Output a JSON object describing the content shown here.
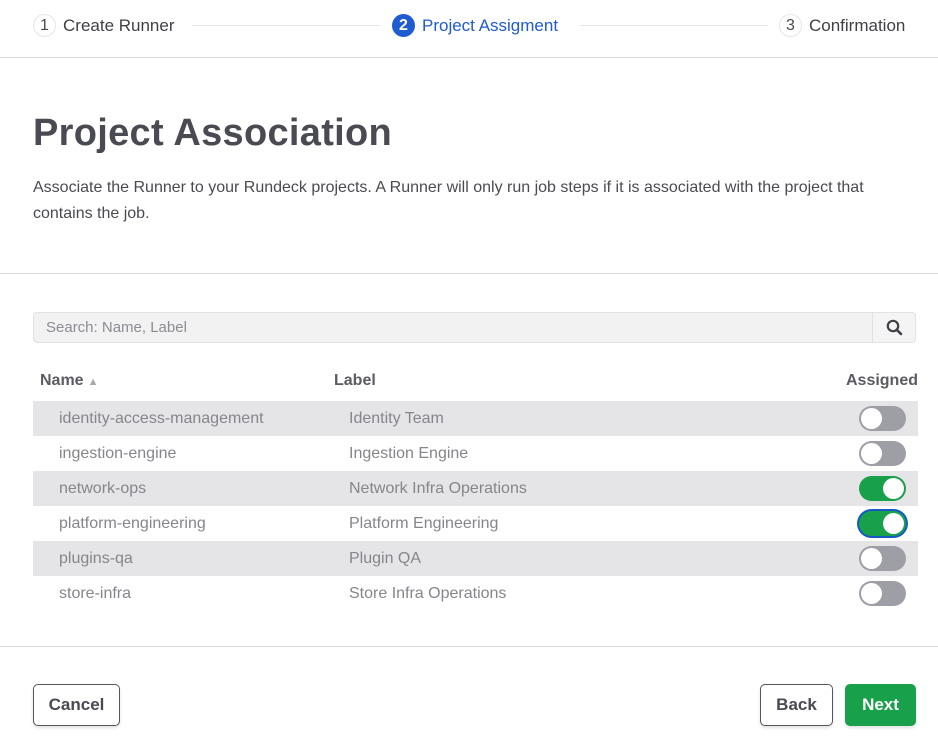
{
  "stepper": {
    "steps": [
      {
        "number": "1",
        "label": "Create Runner",
        "state": "inactive"
      },
      {
        "number": "2",
        "label": "Project Assigment",
        "state": "active"
      },
      {
        "number": "3",
        "label": "Confirmation",
        "state": "inactive"
      }
    ]
  },
  "page": {
    "title": "Project Association",
    "description": "Associate the Runner to your Rundeck projects. A Runner will only run job steps if it is associated with the project that contains the job."
  },
  "search": {
    "placeholder": "Search: Name, Label",
    "value": "",
    "icon": "search-icon"
  },
  "table": {
    "columns": {
      "name": "Name",
      "name_sort_indicator": "▲",
      "label": "Label",
      "assigned": "Assigned"
    },
    "rows": [
      {
        "name": "identity-access-management",
        "label": "Identity Team",
        "assigned": false
      },
      {
        "name": "ingestion-engine",
        "label": "Ingestion Engine",
        "assigned": false
      },
      {
        "name": "network-ops",
        "label": "Network Infra Operations",
        "assigned": true
      },
      {
        "name": "platform-engineering",
        "label": "Platform Engineering",
        "assigned": true,
        "focused": true
      },
      {
        "name": "plugins-qa",
        "label": "Plugin QA",
        "assigned": false
      },
      {
        "name": "store-infra",
        "label": "Store Infra Operations",
        "assigned": false
      }
    ]
  },
  "footer": {
    "cancel_label": "Cancel",
    "back_label": "Back",
    "next_label": "Next"
  },
  "colors": {
    "active_step": "#1f5bd1",
    "primary_green": "#19a04b",
    "toggle_off": "#9e9ea6",
    "focus_ring": "#1559c9"
  }
}
